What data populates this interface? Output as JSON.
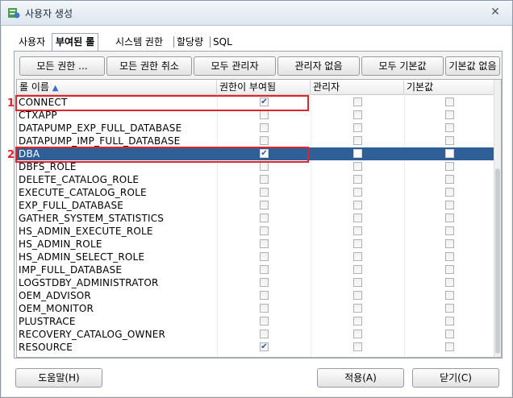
{
  "window": {
    "title": "사용자 생성",
    "close_glyph": "✕"
  },
  "tabs": [
    {
      "label": "사용자",
      "active": false
    },
    {
      "label": "부여된 롤",
      "active": true
    },
    {
      "label": "시스템 권한",
      "active": false
    },
    {
      "label": "할당량",
      "active": false
    },
    {
      "label": "SQL",
      "active": false
    }
  ],
  "toolbar": [
    {
      "label": "모든 권한 ..."
    },
    {
      "label": "모든 권한 취소"
    },
    {
      "label": "모두 관리자"
    },
    {
      "label": "관리자 없음"
    },
    {
      "label": "모두 기본값"
    },
    {
      "label": "기본값 없음"
    }
  ],
  "columns": {
    "name": "롤 이름",
    "granted": "권한이 부여됨",
    "admin": "관리자",
    "default": "기본값"
  },
  "rows": [
    {
      "name": "CONNECT",
      "granted": true,
      "admin": false,
      "default": false
    },
    {
      "name": "CTXAPP",
      "granted": false,
      "admin": false,
      "default": false
    },
    {
      "name": "DATAPUMP_EXP_FULL_DATABASE",
      "granted": false,
      "admin": false,
      "default": false
    },
    {
      "name": "DATAPUMP_IMP_FULL_DATABASE",
      "granted": false,
      "admin": false,
      "default": false
    },
    {
      "name": "DBA",
      "granted": true,
      "admin": false,
      "default": false,
      "selected": true
    },
    {
      "name": "DBFS_ROLE",
      "granted": false,
      "admin": false,
      "default": false
    },
    {
      "name": "DELETE_CATALOG_ROLE",
      "granted": false,
      "admin": false,
      "default": false
    },
    {
      "name": "EXECUTE_CATALOG_ROLE",
      "granted": false,
      "admin": false,
      "default": false
    },
    {
      "name": "EXP_FULL_DATABASE",
      "granted": false,
      "admin": false,
      "default": false
    },
    {
      "name": "GATHER_SYSTEM_STATISTICS",
      "granted": false,
      "admin": false,
      "default": false
    },
    {
      "name": "HS_ADMIN_EXECUTE_ROLE",
      "granted": false,
      "admin": false,
      "default": false
    },
    {
      "name": "HS_ADMIN_ROLE",
      "granted": false,
      "admin": false,
      "default": false
    },
    {
      "name": "HS_ADMIN_SELECT_ROLE",
      "granted": false,
      "admin": false,
      "default": false
    },
    {
      "name": "IMP_FULL_DATABASE",
      "granted": false,
      "admin": false,
      "default": false
    },
    {
      "name": "LOGSTDBY_ADMINISTRATOR",
      "granted": false,
      "admin": false,
      "default": false
    },
    {
      "name": "OEM_ADVISOR",
      "granted": false,
      "admin": false,
      "default": false
    },
    {
      "name": "OEM_MONITOR",
      "granted": false,
      "admin": false,
      "default": false
    },
    {
      "name": "PLUSTRACE",
      "granted": false,
      "admin": false,
      "default": false
    },
    {
      "name": "RECOVERY_CATALOG_OWNER",
      "granted": false,
      "admin": false,
      "default": false
    },
    {
      "name": "RESOURCE",
      "granted": true,
      "admin": false,
      "default": false
    }
  ],
  "callouts": [
    {
      "label": "1"
    },
    {
      "label": "2"
    }
  ],
  "footer": {
    "help": "도움말(H)",
    "apply": "적용(A)",
    "close": "닫기(C)"
  },
  "icons": {
    "sort": "sort-ascending-icon",
    "check": "checkmark-icon"
  },
  "colors": {
    "selection": "#2f5f97",
    "callout": "#e0242b",
    "check": "#2a5aa8"
  }
}
